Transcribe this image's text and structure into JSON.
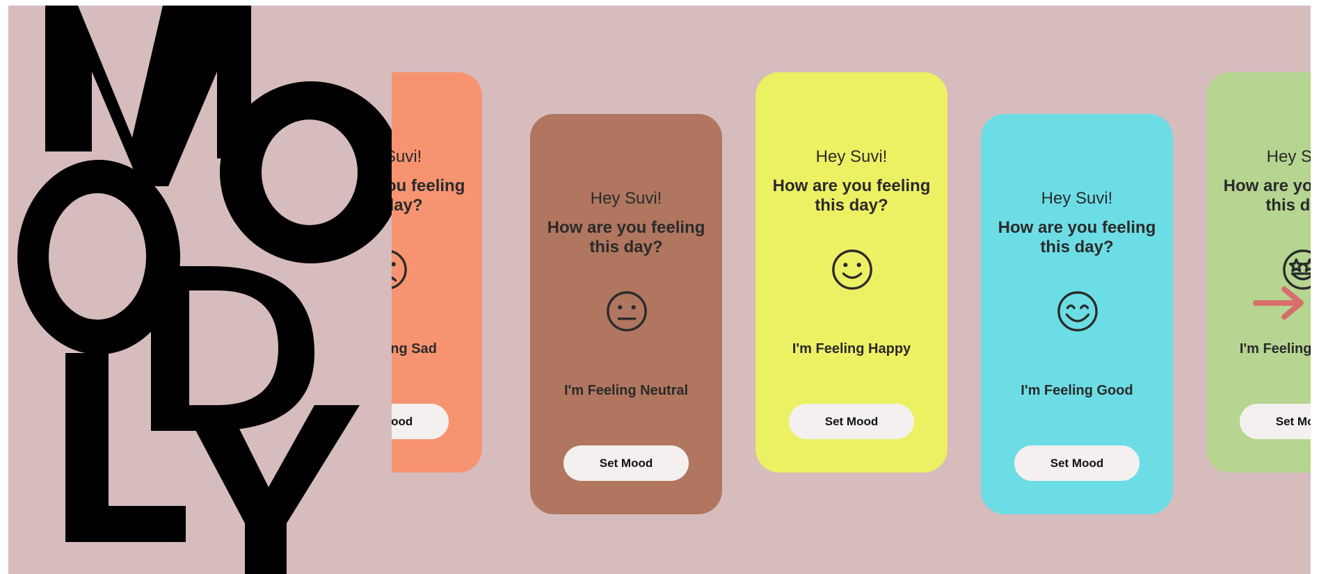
{
  "logo": {
    "text": "MOODLY",
    "letters": [
      "M",
      "O",
      "O",
      "D",
      "L",
      "Y"
    ]
  },
  "cards": [
    {
      "id": "sad",
      "color": "#f69471",
      "greeting": "Hey Suvi!",
      "question": "How are you feeling this day?",
      "face_icon": "sad-face-icon",
      "mood_label": "I'm Feeling Sad",
      "button_label": "Set Mood"
    },
    {
      "id": "neutral",
      "color": "#b07660",
      "greeting": "Hey Suvi!",
      "question": "How are you feeling this day?",
      "face_icon": "neutral-face-icon",
      "mood_label": "I'm Feeling Neutral",
      "button_label": "Set Mood"
    },
    {
      "id": "happy",
      "color": "#ecf063",
      "greeting": "Hey Suvi!",
      "question": "How are you feeling this day?",
      "face_icon": "happy-face-icon",
      "mood_label": "I'm Feeling Happy",
      "button_label": "Set Mood"
    },
    {
      "id": "good",
      "color": "#6ddde5",
      "greeting": "Hey Suvi!",
      "question": "How are you feeling this day?",
      "face_icon": "good-face-icon",
      "mood_label": "I'm Feeling Good",
      "button_label": "Set Mood"
    },
    {
      "id": "excited",
      "color": "#b5d590",
      "greeting": "Hey Suvi!",
      "question": "How are you feeling this day?",
      "face_icon": "star-eyes-face-icon",
      "mood_label": "I'm Feeling Excited",
      "button_label": "Set Mood"
    }
  ],
  "next_arrow": {
    "icon": "arrow-right-icon",
    "color": "#d86e6b"
  },
  "colors": {
    "background": "#d6bcbd",
    "text": "#2a2a2a",
    "button": "#f4f0ef"
  }
}
